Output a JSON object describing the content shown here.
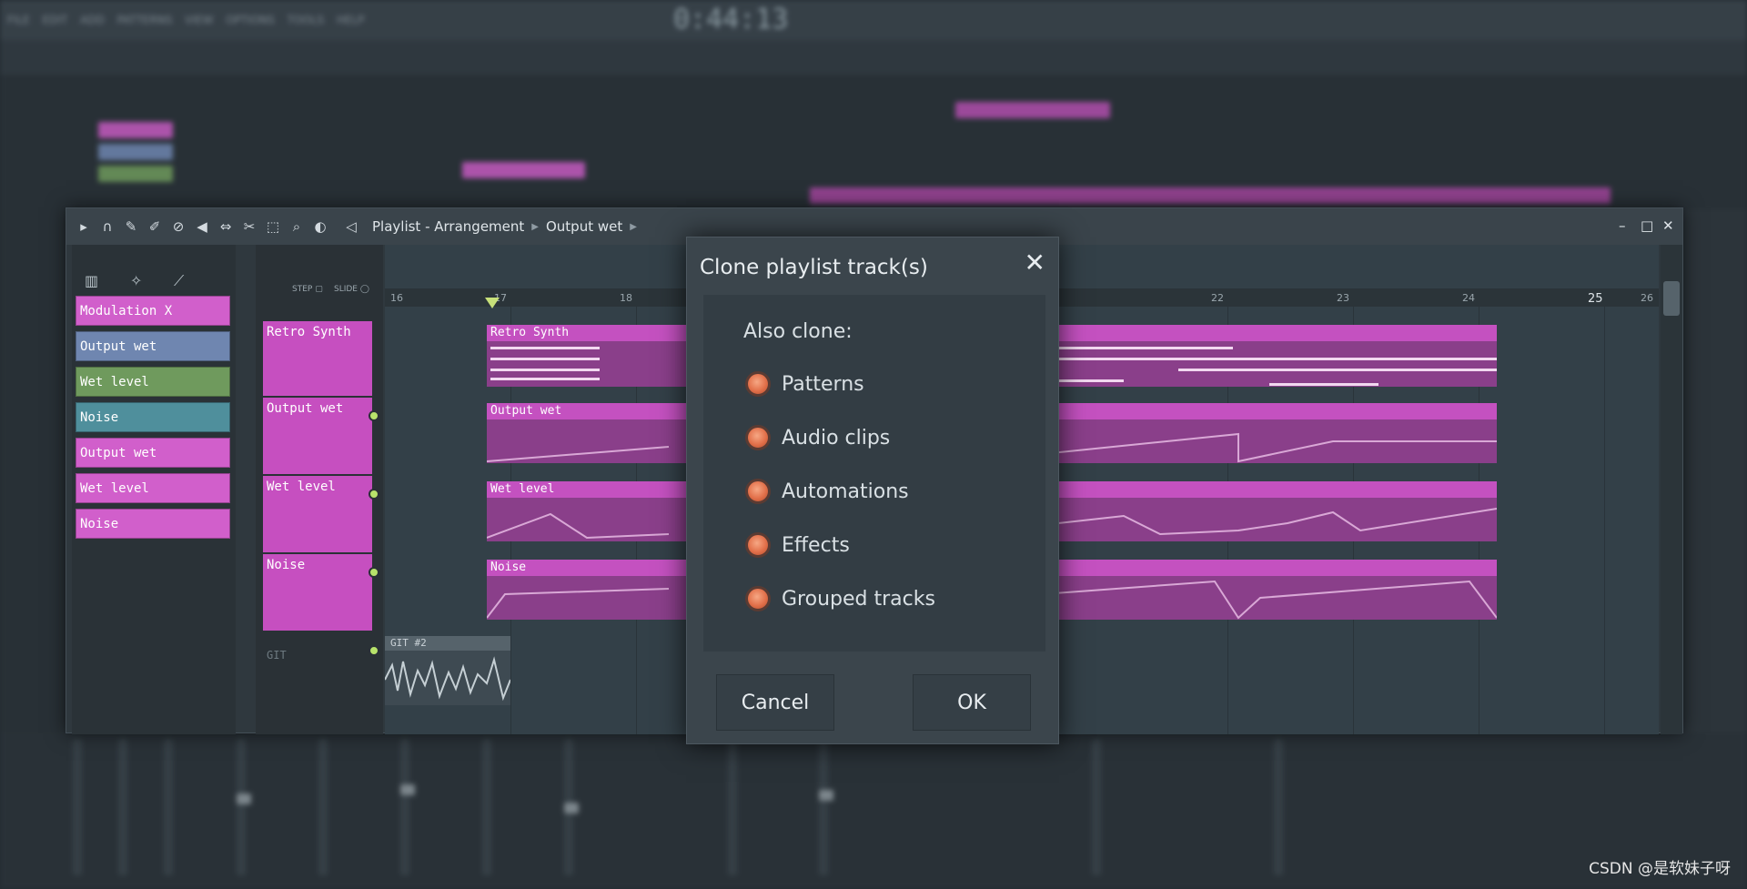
{
  "app": {
    "time_display": "0:44:13",
    "background_menu": [
      "FILE",
      "EDIT",
      "ADD",
      "PATTERNS",
      "VIEW",
      "OPTIONS",
      "TOOLS",
      "HELP"
    ]
  },
  "playlist": {
    "breadcrumb": [
      "Playlist - Arrangement",
      "Output wet"
    ],
    "picker_tracks": [
      {
        "label": "Modulation X",
        "color": "#d15fcb"
      },
      {
        "label": "Output wet",
        "color": "#6f86b0"
      },
      {
        "label": "Wet level",
        "color": "#6f9a5d"
      },
      {
        "label": "Noise",
        "color": "#4f8f9c"
      },
      {
        "label": "Output wet",
        "color": "#d15fcb"
      },
      {
        "label": "Wet level",
        "color": "#d15fcb"
      },
      {
        "label": "Noise",
        "color": "#d15fcb"
      }
    ],
    "track_headers": [
      "Retro Synth",
      "Output wet",
      "Wet level",
      "Noise"
    ],
    "git_label": "GIT",
    "git_clip": "GIT #2",
    "step_label": "STEP",
    "slide_label": "SLIDE",
    "ruler": [
      "16",
      "17",
      "18",
      "22",
      "23",
      "24",
      "25",
      "26"
    ],
    "clips": [
      "Retro Synth",
      "Output wet",
      "Wet level",
      "Noise"
    ]
  },
  "dialog": {
    "title": "Clone playlist track(s)",
    "section_label": "Also clone:",
    "options": [
      "Patterns",
      "Audio clips",
      "Automations",
      "Effects",
      "Grouped tracks"
    ],
    "cancel_label": "Cancel",
    "ok_label": "OK",
    "accent_color": "#e2704a"
  },
  "watermark": "CSDN @是软妹子呀"
}
